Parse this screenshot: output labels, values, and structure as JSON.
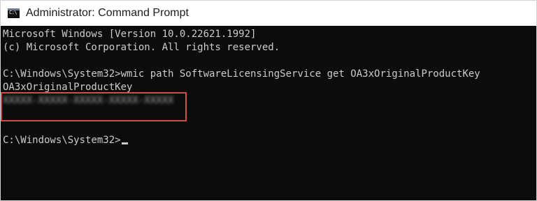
{
  "window": {
    "title": "Administrator: Command Prompt",
    "icon": "terminal-icon",
    "icon_text": "C:\\"
  },
  "console": {
    "lines": [
      "Microsoft Windows [Version 10.0.22621.1992]",
      "(c) Microsoft Corporation. All rights reserved.",
      "C:\\Windows\\System32>wmic path SoftwareLicensingService get OA3xOriginalProductKey",
      "OA3xOriginalProductKey",
      "XXXXX-XXXXX-XXXXX-XXXXX-XXXXX"
    ],
    "prompt": "C:\\Windows\\System32>"
  },
  "colors": {
    "background": "#0c0c0c",
    "foreground": "#cccccc",
    "highlight_border": "#d64c4c"
  }
}
